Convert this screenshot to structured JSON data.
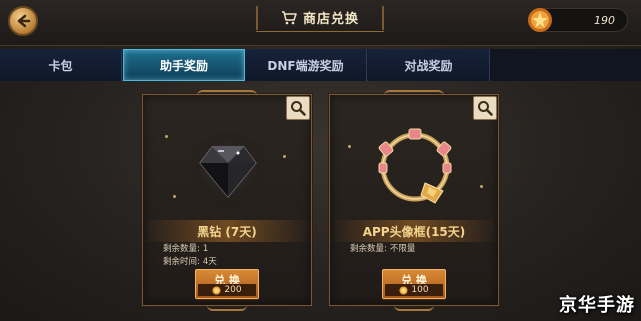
{
  "header": {
    "title": "商店兑换",
    "currency_value": "190"
  },
  "tabs": [
    {
      "label": "卡包",
      "active": false
    },
    {
      "label": "助手奖励",
      "active": true
    },
    {
      "label": "DNF端游奖励",
      "active": false
    },
    {
      "label": "对战奖励",
      "active": false
    }
  ],
  "items": [
    {
      "name": "黑钻 (7天)",
      "remaining_qty_label": "剩余数量:",
      "remaining_qty": "1",
      "remaining_time_label": "剩余时间:",
      "remaining_time": "4天",
      "redeem_label": "兑 换",
      "price": "200",
      "icon": "black-diamond-icon"
    },
    {
      "name": "APP头像框(15天)",
      "remaining_qty_label": "剩余数量:",
      "remaining_qty": "不限量",
      "redeem_label": "兑 换",
      "price": "100",
      "icon": "avatar-frame-icon"
    }
  ],
  "watermark": "京华手游",
  "colors": {
    "accent_gold": "#d98a36",
    "tab_active": "#1f6f8f",
    "background": "#26221f"
  }
}
